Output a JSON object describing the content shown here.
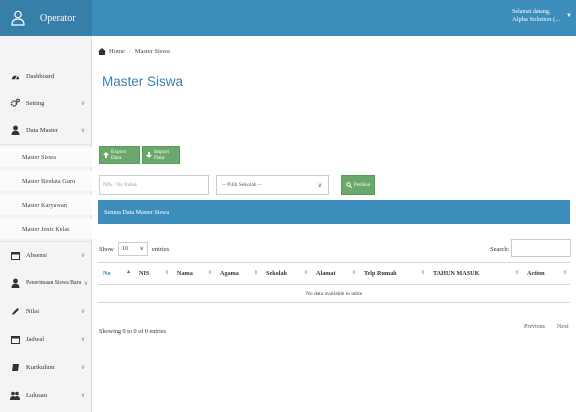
{
  "header": {
    "brand": "Operator",
    "greeting": "Selamat datang,",
    "user_name": "Alpha Solution (..."
  },
  "sidebar": {
    "items": [
      {
        "label": "Dashboard",
        "icon": "dashboard-icon"
      },
      {
        "label": "Setting",
        "icon": "cogs-icon"
      },
      {
        "label": "Data Master",
        "icon": "user-icon"
      },
      {
        "label": "Absensi",
        "icon": "calendar-icon"
      },
      {
        "label": "Penerimaan Siswa Baru",
        "icon": "user-icon"
      },
      {
        "label": "Nilai",
        "icon": "pencil-icon"
      },
      {
        "label": "Jadwal",
        "icon": "calendar-icon"
      },
      {
        "label": "Kurikulum",
        "icon": "book-icon"
      },
      {
        "label": "Lulusan",
        "icon": "users-icon"
      }
    ],
    "sub_items": [
      "Master Siswa",
      "Master Biodata Guru",
      "Master Karyawan",
      "Master Jenis Kelas"
    ]
  },
  "breadcrumb": {
    "home": "Home",
    "current": "Master Siswa"
  },
  "page": {
    "title": "Master Siswa"
  },
  "toolbar": {
    "export_label": "Export Data",
    "import_label": "Import Data"
  },
  "filters": {
    "nis_placeholder": "NIS / No Induk",
    "school_select": "-- Pilih Sekolah --",
    "search_button": "Periksa"
  },
  "panel": {
    "title": "Semua Data Master Siswa"
  },
  "table_controls": {
    "show_label": "Show",
    "entries_value": "10",
    "entries_label": "entries",
    "search_label": "Search:"
  },
  "table": {
    "columns": [
      "No",
      "NIS",
      "Nama",
      "Agama",
      "Sekolah",
      "Alamat",
      "Telp Rumah",
      "TAHUN MASUK",
      "Action"
    ],
    "empty_message": "No data available in table"
  },
  "footer": {
    "info": "Showing 0 to 0 of 0 entries",
    "previous": "Previous",
    "next": "Next"
  },
  "colors": {
    "header": "#3c8dbc",
    "brand": "#367fa9",
    "title": "#3c7fb1",
    "button": "#6ba86b"
  }
}
